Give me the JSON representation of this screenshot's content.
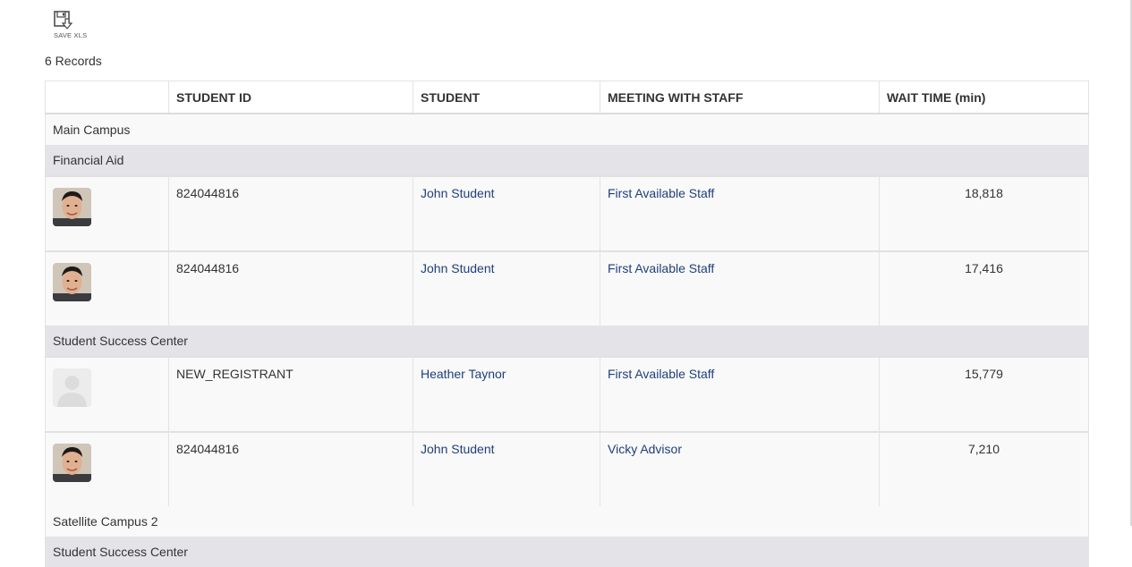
{
  "toolbar": {
    "save_label": "SAVE XLS",
    "save_icon": "floppy-disk-download-icon"
  },
  "records_label": "6 Records",
  "columns": [
    "",
    "STUDENT ID",
    "STUDENT",
    "MEETING WITH STAFF",
    "WAIT TIME (min)"
  ],
  "groups": [
    {
      "campus": "Main Campus",
      "departments": [
        {
          "name": "Financial Aid",
          "rows": [
            {
              "photo": "student-photo",
              "student_id": "824044816",
              "student": "John Student",
              "staff": "First Available Staff",
              "wait": "18,818"
            },
            {
              "photo": "student-photo",
              "student_id": "824044816",
              "student": "John Student",
              "staff": "First Available Staff",
              "wait": "17,416"
            }
          ]
        },
        {
          "name": "Student Success Center",
          "rows": [
            {
              "photo": "placeholder-avatar",
              "student_id": "NEW_REGISTRANT",
              "student": "Heather Taynor",
              "staff": "First Available Staff",
              "wait": "15,779"
            },
            {
              "photo": "student-photo",
              "student_id": "824044816",
              "student": "John Student",
              "staff": "Vicky Advisor",
              "wait": "7,210"
            }
          ]
        }
      ]
    },
    {
      "campus": "Satellite Campus 2",
      "departments": [
        {
          "name": "Student Success Center",
          "rows": []
        }
      ]
    }
  ]
}
